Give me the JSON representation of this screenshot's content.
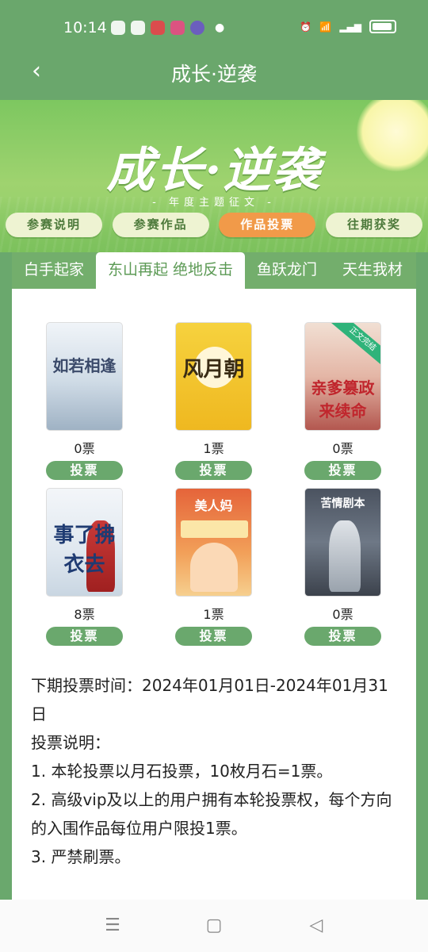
{
  "status": {
    "time": "10:14"
  },
  "header": {
    "title": "成长·逆袭"
  },
  "banner": {
    "title": "成长·逆袭",
    "subtitle": "- 年度主题征文 -",
    "pills": [
      "参赛说明",
      "参赛作品",
      "作品投票",
      "往期获奖"
    ],
    "active_pill": 2
  },
  "tabs": {
    "items": [
      "白手起家",
      "东山再起 绝地反击",
      "鱼跃龙门",
      "天生我材"
    ],
    "active": 1
  },
  "books": [
    {
      "cover_text": "如若相逢",
      "votes": "0票",
      "button": "投票"
    },
    {
      "cover_text": "风月朝",
      "votes": "1票",
      "button": "投票"
    },
    {
      "cover_text": "亲爹篡政来续命",
      "ribbon": "正文完结",
      "votes": "0票",
      "button": "投票"
    },
    {
      "cover_text": "事了拂衣去",
      "votes": "8票",
      "button": "投票"
    },
    {
      "cover_text": "美人妈",
      "votes": "1票",
      "button": "投票"
    },
    {
      "cover_text": "苦情剧本",
      "votes": "0票",
      "button": "投票"
    }
  ],
  "info": {
    "next_vote": "下期投票时间：2024年01月01日-2024年01月31日",
    "heading": "投票说明：",
    "rules": [
      "1. 本轮投票以月石投票，10枚月石=1票。",
      "2. 高级vip及以上的用户拥有本轮投票权，每个方向的入围作品每位用户限投1票。",
      "3. 严禁刷票。"
    ]
  },
  "navbar": {
    "menu_icon": "☰",
    "home_icon": "▢",
    "back_icon": "◁"
  }
}
